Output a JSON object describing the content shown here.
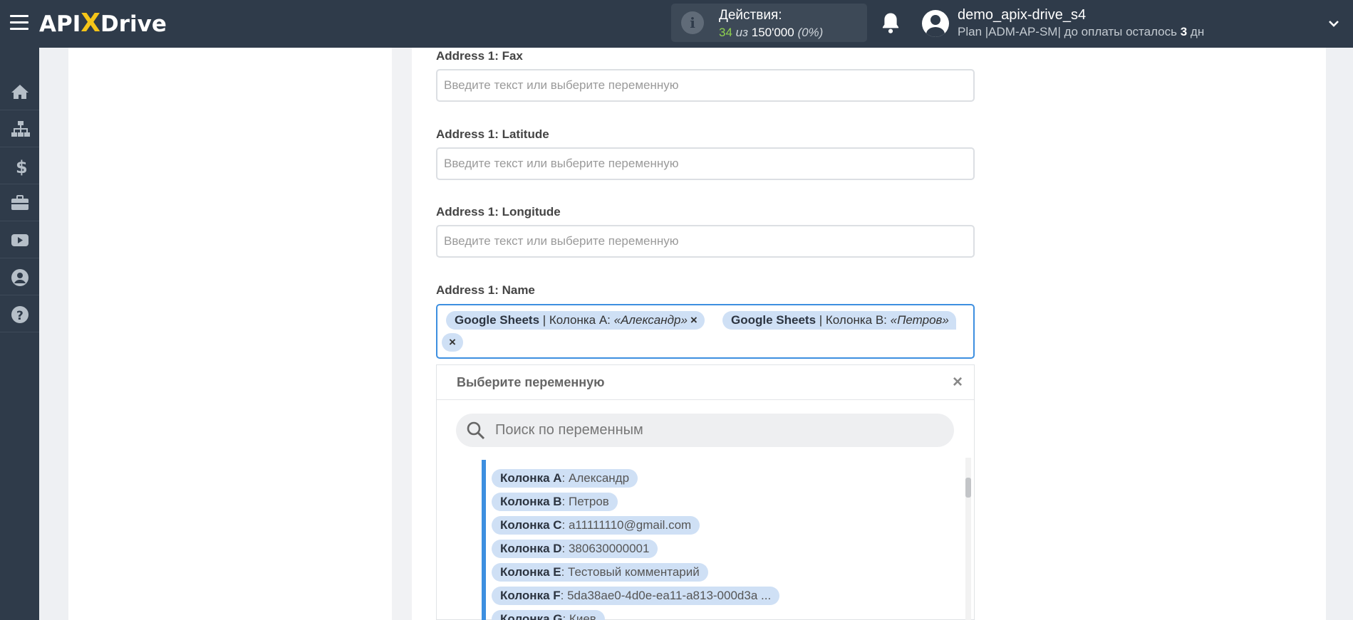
{
  "header": {
    "logo_left": "API",
    "logo_x": "X",
    "logo_right": "Drive",
    "actions_title": "Действия:",
    "actions_used": "34",
    "actions_sep": " из ",
    "actions_total": "150'000",
    "actions_percent": " (0%)",
    "username": "demo_apix-drive_s4",
    "plan_prefix": "Plan |ADM-AP-SM| до оплаты осталось ",
    "plan_days": "3",
    "plan_suffix": " дн"
  },
  "sidebar": {
    "items": [
      "home-icon",
      "sitemap-icon",
      "dollar-icon",
      "briefcase-icon",
      "youtube-icon",
      "user-icon",
      "help-icon"
    ]
  },
  "form": {
    "fields": [
      {
        "label": "Address 1: Fax",
        "placeholder": "Введите текст или выберите переменную"
      },
      {
        "label": "Address 1: Latitude",
        "placeholder": "Введите текст или выберите переменную"
      },
      {
        "label": "Address 1: Longitude",
        "placeholder": "Введите текст или выберите переменную"
      }
    ],
    "name_label": "Address 1: Name",
    "name_chips": [
      {
        "source": "Google Sheets",
        "column": " | Колонка A: ",
        "value": "«Александр»",
        "remove": "×"
      },
      {
        "source": "Google Sheets",
        "column": " | Колонка B: ",
        "value": "«Петров»",
        "remove": "×"
      }
    ]
  },
  "dropdown": {
    "title": "Выберите переменную",
    "close": "×",
    "search_placeholder": "Поиск по переменным",
    "variables": [
      {
        "name": "Колонка A",
        "value": ": Александр"
      },
      {
        "name": "Колонка B",
        "value": ": Петров"
      },
      {
        "name": "Колонка C",
        "value": ": a11111110@gmail.com"
      },
      {
        "name": "Колонка D",
        "value": ": 380630000001"
      },
      {
        "name": "Колонка E",
        "value": ": Тестовый комментарий"
      },
      {
        "name": "Колонка F",
        "value": ": 5da38ae0-4d0e-ea11-a813-000d3a ..."
      },
      {
        "name": "Колонка G",
        "value": ": Киев"
      }
    ]
  },
  "colors": {
    "topbar": "#2f3b4a",
    "accent": "#3d8fe0",
    "chip": "#cfe0f5",
    "used_green": "#8fd14f",
    "logo_x": "#f5c518"
  }
}
